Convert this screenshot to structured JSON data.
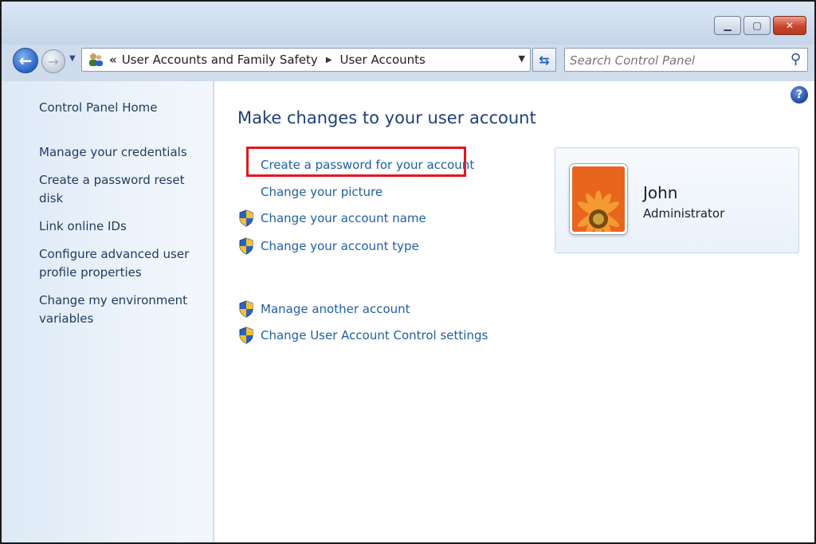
{
  "window": {
    "minimize_glyph": "▁",
    "maximize_glyph": "▢",
    "close_glyph": "✕"
  },
  "nav": {
    "breadcrumb": [
      "User Accounts and Family Safety",
      "User Accounts"
    ],
    "search_placeholder": "Search Control Panel"
  },
  "sidebar": {
    "home": "Control Panel Home",
    "links": [
      "Manage your credentials",
      "Create a password reset disk",
      "Link online IDs",
      "Configure advanced user profile properties",
      "Change my environment variables"
    ]
  },
  "main": {
    "title": "Make changes to your user account",
    "tasks": [
      {
        "label": "Create a password for your account",
        "shield": false,
        "highlighted": true
      },
      {
        "label": "Change your picture",
        "shield": false,
        "highlighted": false
      },
      {
        "label": "Change your account name",
        "shield": true,
        "highlighted": false
      },
      {
        "label": "Change your account type",
        "shield": true,
        "highlighted": false
      },
      {
        "label": "Manage another account",
        "shield": true,
        "highlighted": false
      },
      {
        "label": "Change User Account Control settings",
        "shield": true,
        "highlighted": false
      }
    ]
  },
  "user": {
    "name": "John",
    "role": "Administrator"
  },
  "colors": {
    "link": "#1e5fa8",
    "highlight": "#e3171f",
    "title": "#1e3f78"
  },
  "icons": [
    "back-arrow-icon",
    "forward-arrow-icon",
    "user-accounts-icon",
    "refresh-icon",
    "search-icon",
    "help-icon",
    "shield-icon"
  ]
}
